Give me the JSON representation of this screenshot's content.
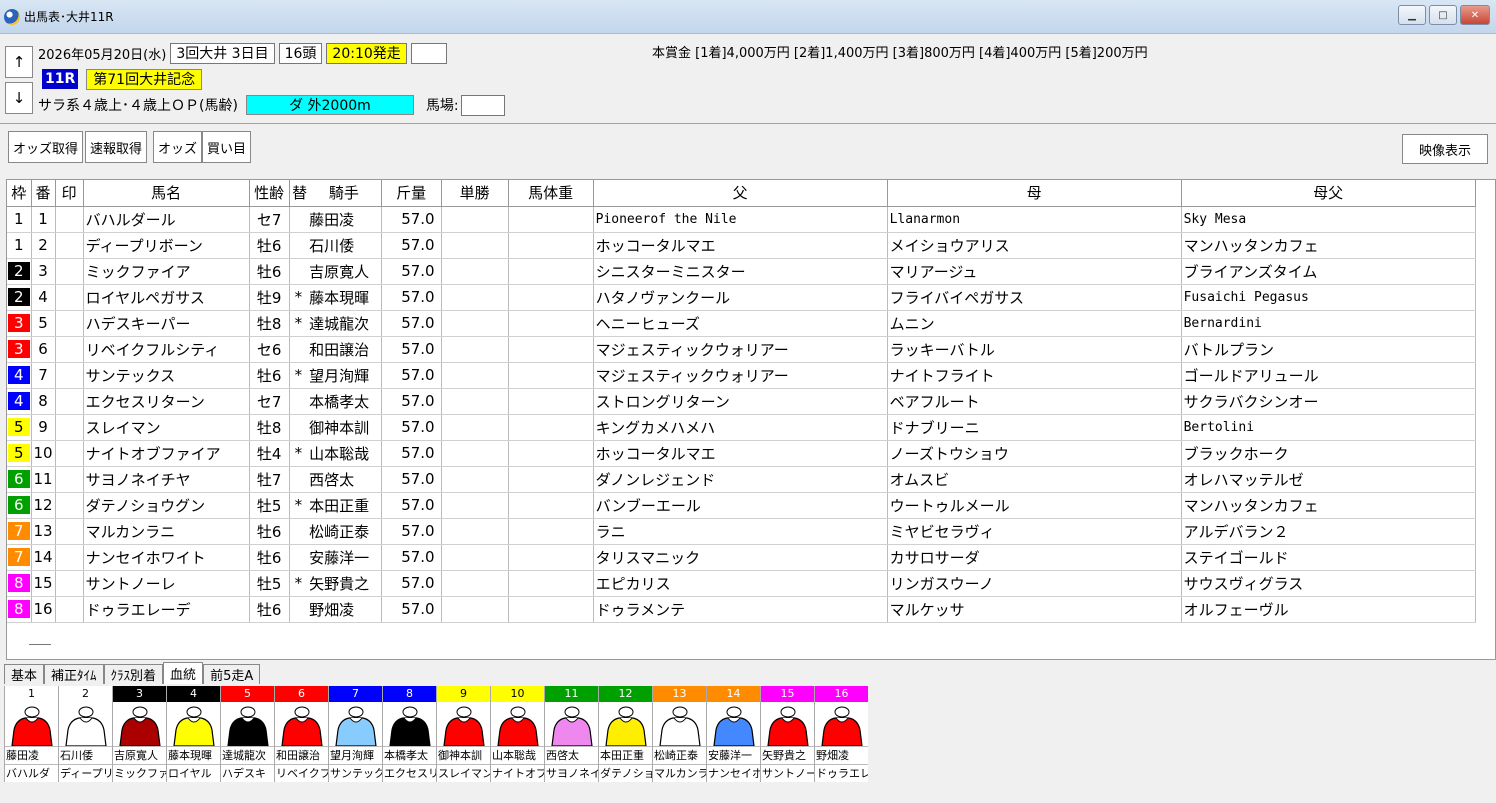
{
  "window": {
    "title": "出馬表･大井11R"
  },
  "race": {
    "date": "2026年05月20日(水)",
    "kai": "3回大井 3日目",
    "heads": "16頭",
    "post_time": "20:10発走",
    "race_no": "11R",
    "race_name": "第71回大井記念",
    "conditions": "サラ系４歳上･４歳上ＯＰ(馬齢)",
    "course": "ダ 外2000m",
    "baba_label": "馬場:",
    "prize": "本賞金 [1着]4,000万円 [2着]1,400万円 [3着]800万円 [4着]400万円 [5着]200万円"
  },
  "toolbar": {
    "odds": "オッズ取得",
    "sokuho": "速報取得",
    "odds2": "オッズ",
    "kaime": "買い目",
    "video": "映像表示"
  },
  "nav": {
    "up": "↑",
    "down": "↓"
  },
  "columns": [
    "枠",
    "番",
    "印",
    "馬名",
    "性齢",
    "替",
    "騎手",
    "斤量",
    "単勝",
    "馬体重",
    "父",
    "母",
    "母父"
  ],
  "waku_colors": {
    "1": [
      "#ffffff",
      "#000000"
    ],
    "2": [
      "#000000",
      "#ffffff"
    ],
    "3": [
      "#ff0000",
      "#ffffff"
    ],
    "4": [
      "#0000ff",
      "#ffffff"
    ],
    "5": [
      "#ffff00",
      "#000000"
    ],
    "6": [
      "#00a000",
      "#ffffff"
    ],
    "7": [
      "#ff8c00",
      "#ffffff"
    ],
    "8": [
      "#ff00ff",
      "#ffffff"
    ]
  },
  "horses": [
    {
      "waku": "1",
      "num": "1",
      "name": "バハルダール",
      "sexage": "セ7",
      "change": "",
      "jockey": "藤田凌",
      "weight": "57.0",
      "sire": "Pioneerof the Nile",
      "dam": "Llanarmon",
      "damsire": "Sky Mesa",
      "jk_short": "藤田凌",
      "name_short": "バハルダ"
    },
    {
      "waku": "1",
      "num": "2",
      "name": "ディープリボーン",
      "sexage": "牡6",
      "change": "",
      "jockey": "石川倭",
      "weight": "57.0",
      "sire": "ホッコータルマエ",
      "dam": "メイショウアリス",
      "damsire": "マンハッタンカフェ",
      "jk_short": "石川倭",
      "name_short": "ディープリ"
    },
    {
      "waku": "2",
      "num": "3",
      "name": "ミックファイア",
      "sexage": "牡6",
      "change": "",
      "jockey": "吉原寛人",
      "weight": "57.0",
      "sire": "シニスターミニスター",
      "dam": "マリアージュ",
      "damsire": "ブライアンズタイム",
      "jk_short": "吉原寛人",
      "name_short": "ミックファ"
    },
    {
      "waku": "2",
      "num": "4",
      "name": "ロイヤルペガサス",
      "sexage": "牡9",
      "change": "*",
      "jockey": "藤本現暉",
      "weight": "57.0",
      "sire": "ハタノヴァンクール",
      "dam": "フライバイペガサス",
      "damsire": "Fusaichi Pegasus",
      "jk_short": "藤本現暉",
      "name_short": "ロイヤル"
    },
    {
      "waku": "3",
      "num": "5",
      "name": "ハデスキーパー",
      "sexage": "牡8",
      "change": "*",
      "jockey": "達城龍次",
      "weight": "57.0",
      "sire": "ヘニーヒューズ",
      "dam": "ムニン",
      "damsire": "Bernardini",
      "jk_short": "達城龍次",
      "name_short": "ハデスキ"
    },
    {
      "waku": "3",
      "num": "6",
      "name": "リベイクフルシティ",
      "sexage": "セ6",
      "change": "",
      "jockey": "和田譲治",
      "weight": "57.0",
      "sire": "マジェスティックウォリアー",
      "dam": "ラッキーバトル",
      "damsire": "バトルプラン",
      "jk_short": "和田譲治",
      "name_short": "リベイクフ"
    },
    {
      "waku": "4",
      "num": "7",
      "name": "サンテックス",
      "sexage": "牡6",
      "change": "*",
      "jockey": "望月洵輝",
      "weight": "57.0",
      "sire": "マジェスティックウォリアー",
      "dam": "ナイトフライト",
      "damsire": "ゴールドアリュール",
      "jk_short": "望月洵輝",
      "name_short": "サンテック"
    },
    {
      "waku": "4",
      "num": "8",
      "name": "エクセスリターン",
      "sexage": "セ7",
      "change": "",
      "jockey": "本橋孝太",
      "weight": "57.0",
      "sire": "ストロングリターン",
      "dam": "ベアフルート",
      "damsire": "サクラバクシンオー",
      "jk_short": "本橋孝太",
      "name_short": "エクセスリ"
    },
    {
      "waku": "5",
      "num": "9",
      "name": "スレイマン",
      "sexage": "牡8",
      "change": "",
      "jockey": "御神本訓",
      "weight": "57.0",
      "sire": "キングカメハメハ",
      "dam": "ドナブリーニ",
      "damsire": "Bertolini",
      "jk_short": "御神本訓",
      "name_short": "スレイマン"
    },
    {
      "waku": "5",
      "num": "10",
      "name": "ナイトオブファイア",
      "sexage": "牡4",
      "change": "*",
      "jockey": "山本聡哉",
      "weight": "57.0",
      "sire": "ホッコータルマエ",
      "dam": "ノーズトウショウ",
      "damsire": "ブラックホーク",
      "jk_short": "山本聡哉",
      "name_short": "ナイトオブ"
    },
    {
      "waku": "6",
      "num": "11",
      "name": "サヨノネイチヤ",
      "sexage": "牡7",
      "change": "",
      "jockey": "西啓太",
      "weight": "57.0",
      "sire": "ダノンレジェンド",
      "dam": "オムスビ",
      "damsire": "オレハマッテルゼ",
      "jk_short": "西啓太",
      "name_short": "サヨノネイ"
    },
    {
      "waku": "6",
      "num": "12",
      "name": "ダテノショウグン",
      "sexage": "牡5",
      "change": "*",
      "jockey": "本田正重",
      "weight": "57.0",
      "sire": "バンブーエール",
      "dam": "ウートゥルメール",
      "damsire": "マンハッタンカフェ",
      "jk_short": "本田正重",
      "name_short": "ダテノショ"
    },
    {
      "waku": "7",
      "num": "13",
      "name": "マルカンラニ",
      "sexage": "牡6",
      "change": "",
      "jockey": "松崎正泰",
      "weight": "57.0",
      "sire": "ラニ",
      "dam": "ミヤビセラヴィ",
      "damsire": "アルデバラン２",
      "jk_short": "松崎正泰",
      "name_short": "マルカンラ"
    },
    {
      "waku": "7",
      "num": "14",
      "name": "ナンセイホワイト",
      "sexage": "牡6",
      "change": "",
      "jockey": "安藤洋一",
      "weight": "57.0",
      "sire": "タリスマニック",
      "dam": "カサロサーダ",
      "damsire": "ステイゴールド",
      "jk_short": "安藤洋一",
      "name_short": "ナンセイホ"
    },
    {
      "waku": "8",
      "num": "15",
      "name": "サントノーレ",
      "sexage": "牡5",
      "change": "*",
      "jockey": "矢野貴之",
      "weight": "57.0",
      "sire": "エピカリス",
      "dam": "リンガスウーノ",
      "damsire": "サウスヴィグラス",
      "jk_short": "矢野貴之",
      "name_short": "サントノー"
    },
    {
      "waku": "8",
      "num": "16",
      "name": "ドゥラエレーデ",
      "sexage": "牡6",
      "change": "",
      "jockey": "野畑凌",
      "weight": "57.0",
      "sire": "ドゥラメンテ",
      "dam": "マルケッサ",
      "damsire": "オルフェーヴル",
      "jk_short": "野畑凌",
      "name_short": "ドゥラエレ"
    }
  ],
  "silks": [
    "#ff0000",
    "#ffffff",
    "#aa0000",
    "#ffff00",
    "#000000",
    "#ff0000",
    "#88ccff",
    "#000000",
    "#ff0000",
    "#ff0000",
    "#ee88ee",
    "#ffee00",
    "#ffffff",
    "#4488ff",
    "#ff0000",
    "#ff0000"
  ],
  "tabs": [
    "基本",
    "補正ﾀｲﾑ",
    "ｸﾗｽ別着",
    "血統",
    "前5走A"
  ],
  "active_tab": "血統"
}
